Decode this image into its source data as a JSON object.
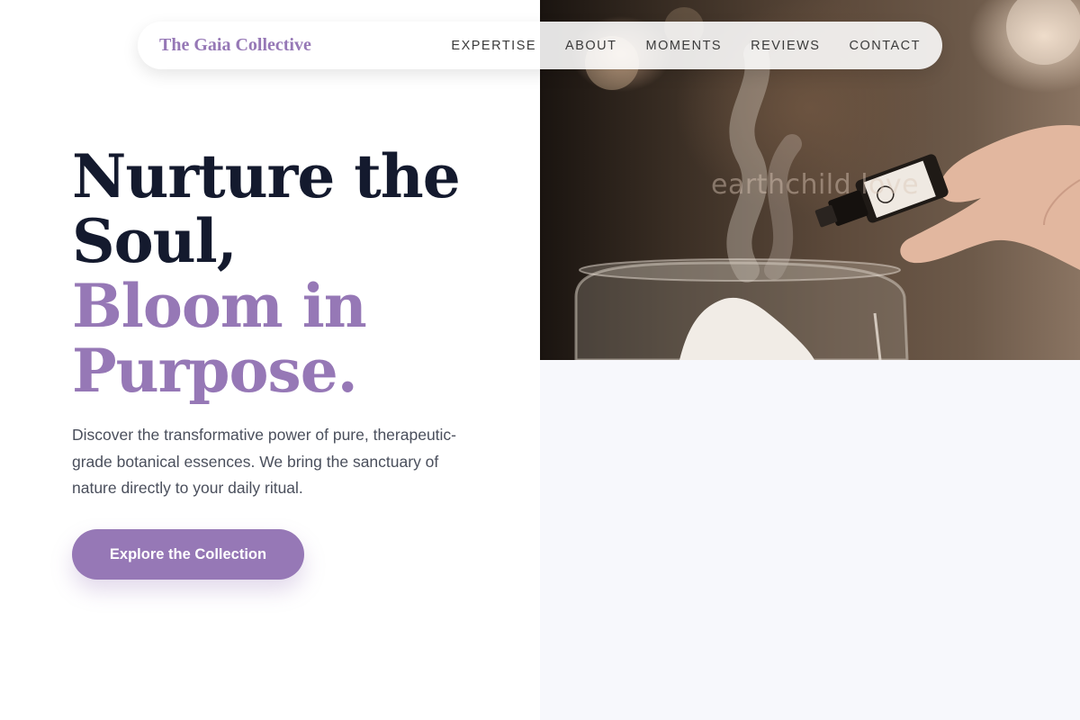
{
  "brand": {
    "name": "The Gaia Collective"
  },
  "nav": {
    "items": [
      {
        "label": "EXPERTISE"
      },
      {
        "label": "ABOUT"
      },
      {
        "label": "MOMENTS"
      },
      {
        "label": "REVIEWS"
      },
      {
        "label": "CONTACT"
      }
    ]
  },
  "hero": {
    "headline_line1": "Nurture the",
    "headline_line2": "Soul,",
    "headline_line3": "Bloom in",
    "headline_line4": "Purpose.",
    "description": "Discover the transformative power of pure, therapeutic-grade botanical essences. We bring the sanctuary of nature directly to your daily ritual.",
    "cta_label": "Explore the Collection",
    "image_watermark": "earthchild love"
  },
  "colors": {
    "accent": "#9678b6",
    "headline_dark": "#141a2e",
    "body_text": "#4a4f5c",
    "right_panel_bg": "#f7f8fc"
  },
  "icons": {
    "hero_photo": "essential-oil-diffuser-photo"
  }
}
